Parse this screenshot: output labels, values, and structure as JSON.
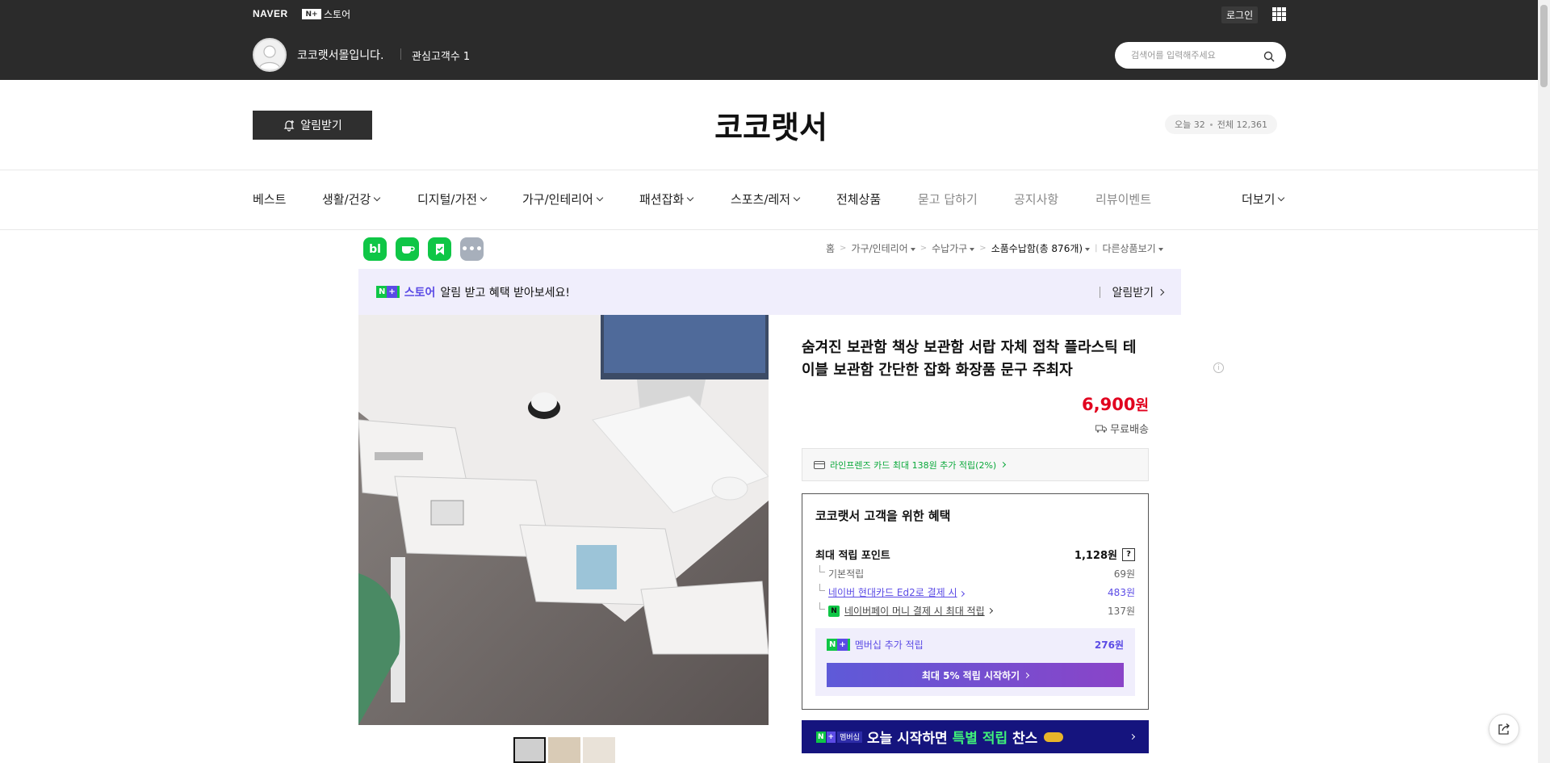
{
  "topbar": {
    "naver": "NAVER",
    "n_plus": "N+",
    "store": "스토어",
    "login": "로그인",
    "apps_icon": "grid-icon",
    "shop_name": "코코랫서몰입니다.",
    "interest_label": "관심고객수 1",
    "search_placeholder": "검색어를 입력해주세요"
  },
  "header": {
    "alarm_label": "알림받기",
    "store_title": "코코랫서",
    "visit_today": "오늘 32",
    "visit_total": "전체 12,361"
  },
  "nav": {
    "items": [
      {
        "label": "베스트"
      },
      {
        "label": "생활/건강"
      },
      {
        "label": "디지털/가전"
      },
      {
        "label": "가구/인테리어"
      },
      {
        "label": "패션잡화"
      },
      {
        "label": "스포츠/레저"
      },
      {
        "label": "전체상품"
      },
      {
        "label": "묻고 답하기"
      },
      {
        "label": "공지사항"
      },
      {
        "label": "리뷰이벤트"
      }
    ],
    "more": "더보기"
  },
  "app_icons": [
    "bl",
    "cup",
    "bookmark",
    "more"
  ],
  "breadcrumb": {
    "home": "홈",
    "c1": "가구/인테리어",
    "c2": "수납가구",
    "c3": "소품수납함(총 876개)",
    "other": "다른상품보기"
  },
  "promo": {
    "n": "N",
    "plus": "+",
    "store": "스토어",
    "message": "알림 받고 혜택 받아보세요!",
    "action": "알림받기"
  },
  "product": {
    "title": "숨겨진 보관함 책상 보관함 서랍 자체 접착 플라스틱 테이블 보관함 간단한 잡화 화장품 문구 주최자",
    "price": "6,900",
    "currency": "원",
    "shipping": "무료배송",
    "card_promo": "라인프렌즈 카드 최대 138원 추가 적립(2%)"
  },
  "benefit": {
    "title": "코코랫서 고객을 위한 혜택",
    "max_point_label": "최대 적립 포인트",
    "max_point_value": "1,128원",
    "help": "?",
    "base_label": "기본적립",
    "base_value": "69원",
    "hyundai_label": "네이버 현대카드 Ed2로 결제 시",
    "hyundai_value": "483원",
    "npay_label": "네이버페이 머니 결제 시 최대 적립",
    "npay_value": "137원",
    "npay_badge": "N",
    "membership_label": "멤버십 추가 적립",
    "membership_value": "276원",
    "membership_button": "최대 5% 적립 시작하기"
  },
  "mem_banner": {
    "tag": "멤버십",
    "text_a": "오늘 시작하면 ",
    "text_hl": "특별 적립",
    "text_b": " 찬스"
  },
  "colors": {
    "topbar": "#2b2b2b",
    "naver_green": "#0fc646",
    "price_red": "#e1001e",
    "purple": "#5b4be5",
    "banner_navy": "#15147e"
  }
}
